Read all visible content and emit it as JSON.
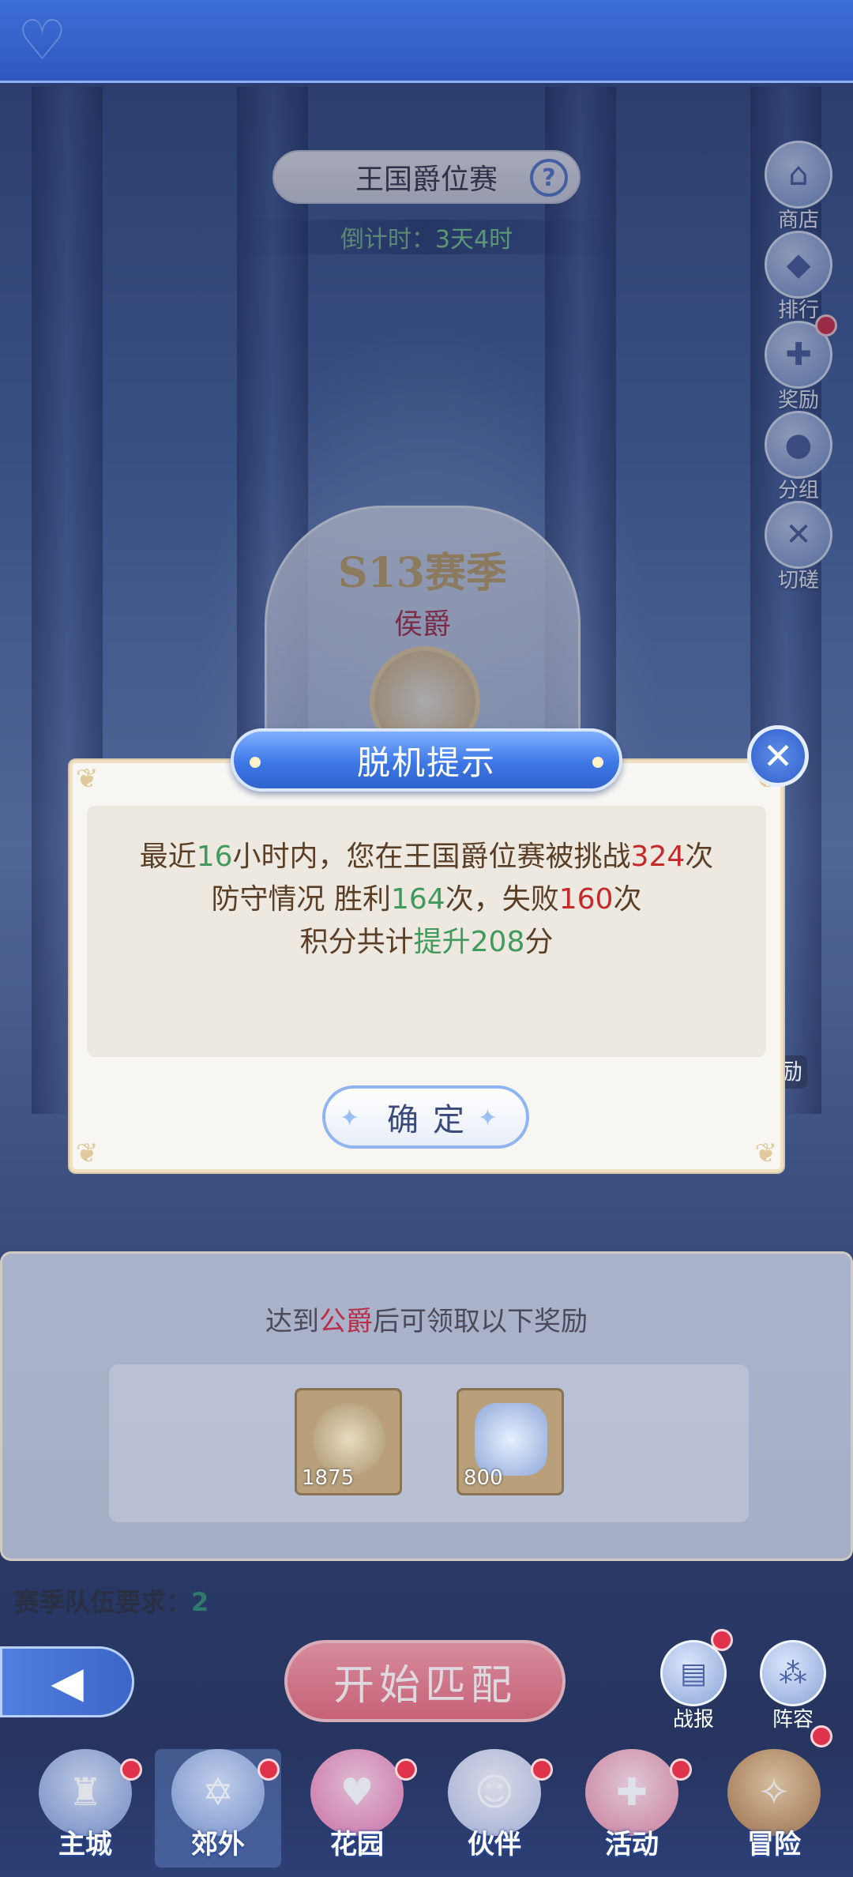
{
  "header": {
    "title": "王国爵位赛",
    "help_icon": "question-icon",
    "countdown_label": "倒计时：",
    "countdown_value": "3天4时"
  },
  "side_menu": [
    {
      "label": "商店",
      "icon": "shop-icon",
      "badge": false
    },
    {
      "label": "排行",
      "icon": "rank-icon",
      "badge": false
    },
    {
      "label": "奖励",
      "icon": "gift-icon",
      "badge": true
    },
    {
      "label": "分组",
      "icon": "group-icon",
      "badge": false
    },
    {
      "label": "切磋",
      "icon": "swords-icon",
      "badge": false
    }
  ],
  "season": {
    "title": "S13赛季",
    "rank": "侯爵"
  },
  "dialog": {
    "title": "脱机提示",
    "line1": {
      "a": "最近",
      "hours": "16",
      "b": "小时内，您在王国爵位赛被挑战",
      "count": "324",
      "c": "次"
    },
    "line2": {
      "a": "防守情况 胜利",
      "wins": "164",
      "b": "次，失败",
      "losses": "160",
      "c": "次"
    },
    "line3": {
      "a": "积分共计",
      "up_word": "提升",
      "points": "208",
      "b": "分"
    },
    "confirm_label": "确定",
    "partial_bg_text": "励"
  },
  "reward": {
    "title_a": "达到",
    "title_rank": "公爵",
    "title_b": "后可领取以下奖励",
    "items": [
      {
        "icon": "crown-coin-icon",
        "count": "1875"
      },
      {
        "icon": "crystal-icon",
        "count": "800"
      }
    ]
  },
  "team": {
    "label": "赛季队伍要求：",
    "value": "2"
  },
  "actions": {
    "start_match": "开始匹配",
    "report": "战报",
    "lineup": "阵容"
  },
  "bottom_nav": [
    {
      "label": "主城",
      "icon": "castle-icon",
      "badge": true
    },
    {
      "label": "郊外",
      "icon": "star-gate-icon",
      "badge": true
    },
    {
      "label": "花园",
      "icon": "heart-planet-icon",
      "badge": true
    },
    {
      "label": "伙伴",
      "icon": "companion-icon",
      "badge": true
    },
    {
      "label": "活动",
      "icon": "gift-box-icon",
      "badge": true
    },
    {
      "label": "冒险",
      "icon": "compass-icon",
      "badge": true
    }
  ],
  "colors": {
    "accent_blue": "#3d78e6",
    "green_text": "#3f9a5c",
    "red_text": "#c42a2a",
    "brown_text": "#5a3e25"
  }
}
